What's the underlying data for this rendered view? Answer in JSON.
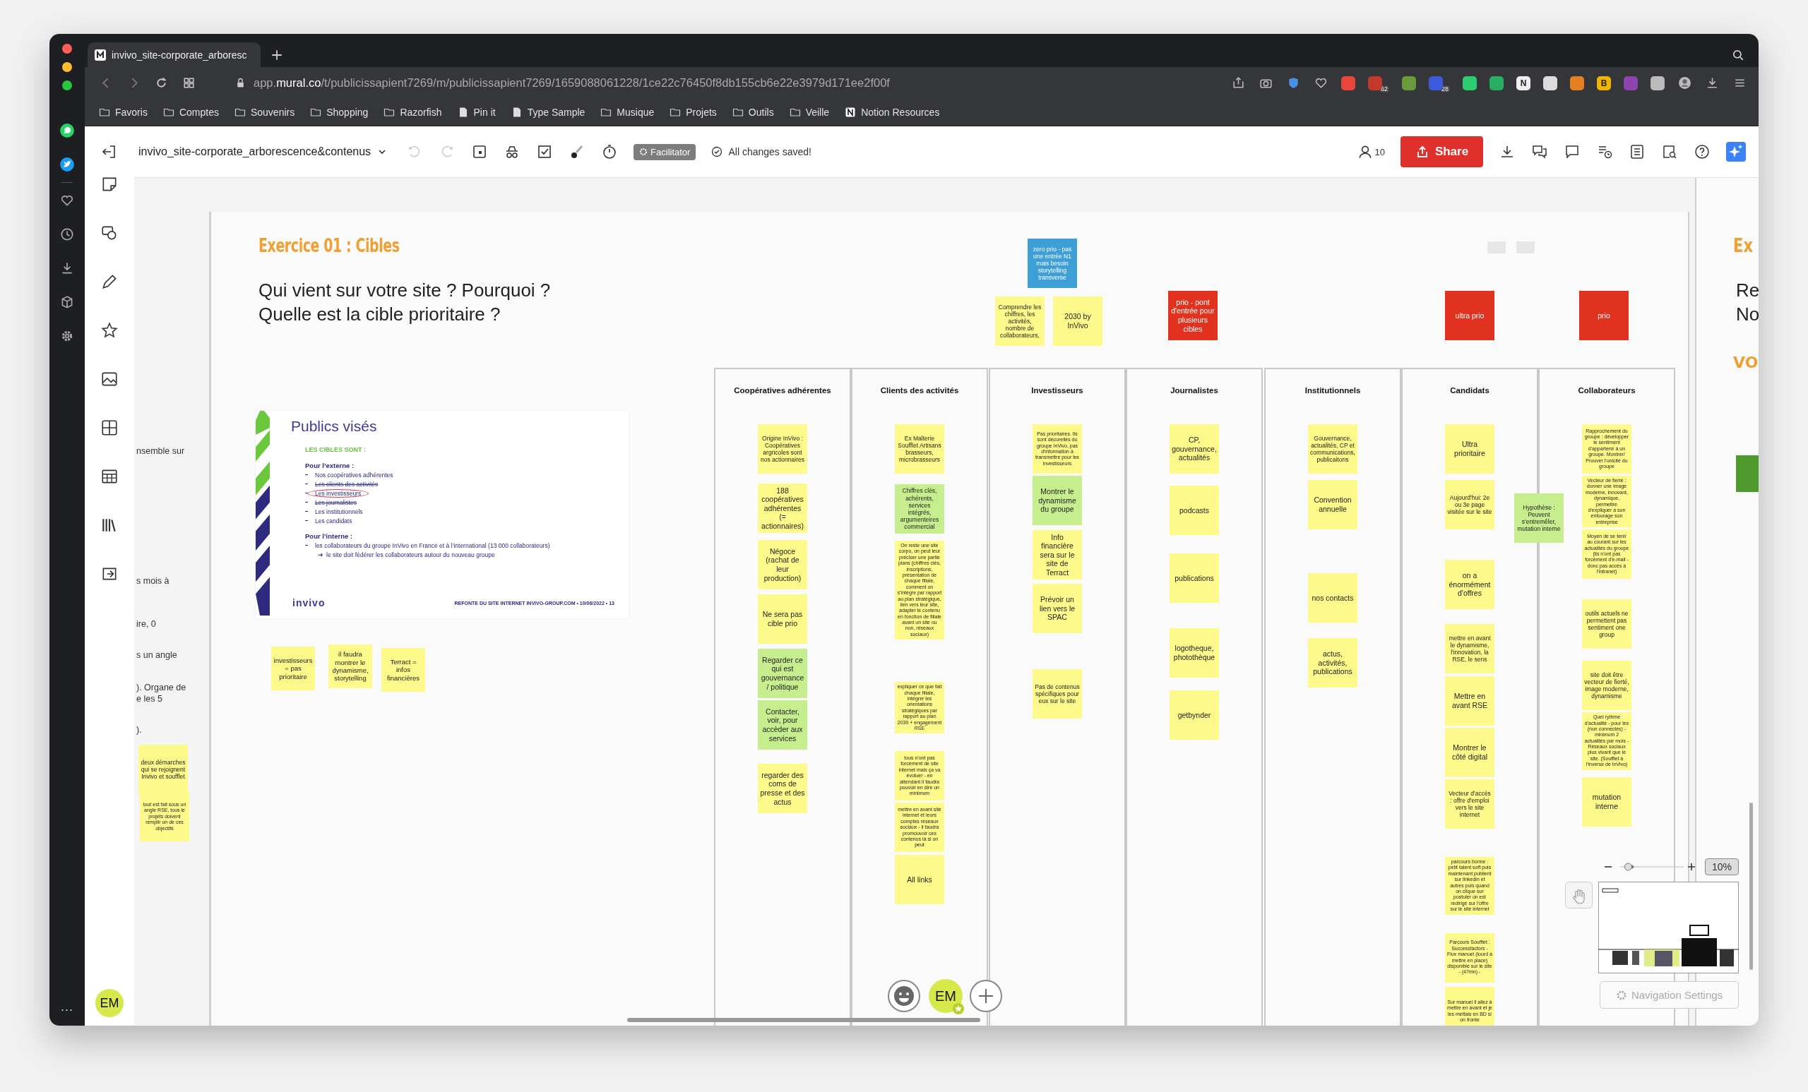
{
  "browser": {
    "tab_title": "invivo_site-corporate_arboresc",
    "url": "app.**mural.co**/t/publicissapient7269/m/publicissapient7269/1659088061228/1ce22c76450f8db155cb6e22e3979d171ee2f00f",
    "more": "...",
    "extensions": [
      {
        "color": "#e8453c"
      },
      {
        "color": "#c0392b",
        "badge": "62"
      },
      {
        "color": "#6a9a3a"
      },
      {
        "color": "#3b5bdb",
        "badge": "28"
      },
      {
        "color": "#2ecc71"
      },
      {
        "color": "#27ae60"
      },
      {
        "color": "#eeeeee",
        "letter": "N"
      },
      {
        "color": "#dddddd"
      },
      {
        "color": "#e67e22"
      },
      {
        "color": "#f1b500",
        "letter": "B"
      },
      {
        "color": "#8e44ad"
      },
      {
        "color": "#bbbbbb"
      }
    ],
    "bookmarks": [
      {
        "label": "Favoris",
        "kind": "folder"
      },
      {
        "label": "Comptes",
        "kind": "folder"
      },
      {
        "label": "Souvenirs",
        "kind": "folder"
      },
      {
        "label": "Shopping",
        "kind": "folder"
      },
      {
        "label": "Razorfish",
        "kind": "folder"
      },
      {
        "label": "Pin it",
        "kind": "page"
      },
      {
        "label": "Type Sample",
        "kind": "page"
      },
      {
        "label": "Musique",
        "kind": "folder"
      },
      {
        "label": "Projets",
        "kind": "folder"
      },
      {
        "label": "Outils",
        "kind": "folder"
      },
      {
        "label": "Veille",
        "kind": "folder"
      },
      {
        "label": "Notion Resources",
        "kind": "notion"
      }
    ]
  },
  "mural": {
    "title": "invivo_site-corporate_arborescence&contenus",
    "facilitator": "Facilitator",
    "saved": "All changes saved!",
    "members": "10",
    "share": "Share",
    "avatar": "EM",
    "facepile_avatar": "EM",
    "zoom": "10%",
    "zoom_slider": {
      "level": 0.08
    },
    "nav_settings": "Navigation Settings"
  },
  "canvas": {
    "left_fragments": [
      "nsemble sur",
      "s mois à",
      "ire, 0",
      "s un angle",
      "). Organe de",
      "e les 5",
      ")."
    ],
    "left_notes": [
      {
        "text": "deux démarches qui se rejoignent Invivo et soufflet",
        "color": "#fdf98a"
      },
      {
        "text": "tout est fait sous un angle RSE, tous le projets doivent remplir un de ces objectifs",
        "color": "#fdf98a"
      }
    ],
    "heading": "Exercice 01 : Cibles",
    "question": [
      "Qui vient sur votre site ? Pourquoi ?",
      "Quelle est la cible prioritaire ?"
    ],
    "slide": {
      "title": "Publics visés",
      "subtitle": "LES CIBLES SONT :",
      "external_label": "Pour l’externe :",
      "external": [
        {
          "text": "Nos coopératives adhérentes",
          "circled": false,
          "struck": false
        },
        {
          "text": "Les clients des activités",
          "circled": false,
          "struck": true
        },
        {
          "text": "Les investisseurs",
          "circled": true,
          "struck": false
        },
        {
          "text": "Les journalistes",
          "circled": false,
          "struck": true
        },
        {
          "text": "Les institutionnels",
          "circled": false,
          "struck": false
        },
        {
          "text": "Les candidats",
          "circled": false,
          "struck": false
        }
      ],
      "internal_label": "Pour l’interne :",
      "internal": "les collaborateurs du groupe InVivo en France et à l’international (13 000 collaborateurs)",
      "internal_arrow": "➔",
      "internal_note": "le site doit fédérer les collaborateurs autour du nouveau groupe",
      "logo": "invivo",
      "footer": "REFONTE DU SITE INTERNET INVIVO-GROUP.COM • 10/06/2022 • 13"
    },
    "under_notes": [
      {
        "text": "investisseurs = pas prioritaire",
        "color": "#fdf98a"
      },
      {
        "text": "il faudra montrer le dynamisme, storytelling",
        "color": "#fdf98a"
      },
      {
        "text": "Terract = infos financières",
        "color": "#fdf98a"
      }
    ],
    "top_notes": [
      {
        "text": "zero prio - pas une entrée N1 mais besoin storytelling transverse",
        "color": "#3d9fd6"
      },
      {
        "text": "Comprendre les chiffres, les activités, nombre de collaborateurs,",
        "color": "#fdf98a"
      },
      {
        "text": "2030 by InVivo",
        "color": "#fdf98a"
      },
      {
        "text": "prio - pont d'entrée pour plusieurs cibles",
        "color": "#e0321f"
      },
      {
        "text": "ultra prio",
        "color": "#e0321f"
      },
      {
        "text": "prio",
        "color": "#e0321f"
      }
    ],
    "columns": [
      {
        "title": "Coopératives adhérentes",
        "notes": [
          {
            "text": "Origine InVivo : Coopératives argricoles sont nos actionnaires",
            "color": "#fdf98a"
          },
          {
            "text": "188 coopératives adhérentes (= actionnaires)",
            "color": "#fdf98a"
          },
          {
            "text": "Négoce (rachat de leur production)",
            "color": "#fdf98a"
          },
          {
            "text": "Ne sera pas cible prio",
            "color": "#fdf98a"
          },
          {
            "text": "Regarder ce qui est gouvernance / politique",
            "color": "#c6ee8e"
          },
          {
            "text": "Contacter, voir, pour accèder aux services",
            "color": "#c6ee8e"
          },
          {
            "text": "regarder des coms de presse et des actus",
            "color": "#fdf98a"
          }
        ]
      },
      {
        "title": "Clients des activités",
        "notes": [
          {
            "text": "Ex Malterie Soufflet Artisans brasseurs, microbrasseurs",
            "color": "#fdf98a"
          },
          {
            "text": "Chiffres clés, achérents, services intégrés, argumenteires commercial",
            "color": "#c6ee8e"
          },
          {
            "text": "On reste une site corpo, on peut leur préciser une partie plans (chiffres clés, inscriptions, présentation de chaque filiale, comment on s'intègre par rapport au plan stratégique, lien vers leur site, adapter le contenu en fonction de filiale avant un site ou non, réseaux sociaux)",
            "color": "#fdf98a"
          },
          {
            "text": "expliquer ce que fait chaque filiale, intégrer les orientations stratégiques par rapport au plan 2030 + engagement RSE",
            "color": "#fdf98a"
          },
          {
            "text": "tous n'ont pas forcément de site internet mais ça va évoluer - en attendant il faudra pouvoir en dire un minimum",
            "color": "#fdf98a"
          },
          {
            "text": "mettre en avant site internet et leurs comptes réseaux sociaux - il faudra promouvoir ces contenus là si on peut",
            "color": "#fdf98a"
          },
          {
            "text": "All links",
            "color": "#fdf98a"
          }
        ]
      },
      {
        "title": "Investisseurs",
        "notes": [
          {
            "text": "Pas prioritaires. Ils sont décorellés du groupe InVivo, pas d'information à transmettre pour les investisseurs",
            "color": "#fdf98a"
          },
          {
            "text": "Montrer le dynamisme du groupe",
            "color": "#c6ee8e"
          },
          {
            "text": "Info financière sera sur le site de Terract",
            "color": "#fdf98a"
          },
          {
            "text": "Prévoir un lien vers le SPAC",
            "color": "#fdf98a"
          },
          {
            "text": "Pas de contenus spécifiques pour eux sur le site",
            "color": "#fdf98a"
          }
        ]
      },
      {
        "title": "Journalistes",
        "notes": [
          {
            "text": "CP, gouvernance, actualités",
            "color": "#fdf98a"
          },
          {
            "text": "podcasts",
            "color": "#fdf98a"
          },
          {
            "text": "publications",
            "color": "#fdf98a"
          },
          {
            "text": "logotheque, photothèque",
            "color": "#fdf98a"
          },
          {
            "text": "getbynder",
            "color": "#fdf98a"
          }
        ]
      },
      {
        "title": "Institutionnels",
        "notes": [
          {
            "text": "Gouvernance, actualités, CP et communications, publicaitons",
            "color": "#fdf98a"
          },
          {
            "text": "Convention annuelle",
            "color": "#fdf98a"
          },
          {
            "text": "nos contacts",
            "color": "#fdf98a"
          },
          {
            "text": "actus, activités, publications",
            "color": "#fdf98a"
          }
        ]
      },
      {
        "title": "Candidats",
        "notes": [
          {
            "text": "Ultra prioritaire",
            "color": "#fdf98a"
          },
          {
            "text": "Aujourd'hui: 2e ou 3e page visitée sur le site",
            "color": "#fdf98a"
          },
          {
            "text": "on a énormément d'offres",
            "color": "#fdf98a"
          },
          {
            "text": "mettre en avant le dynamisme, l'innovation, la RSE, le sens",
            "color": "#fdf98a"
          },
          {
            "text": "Mettre en avant RSE",
            "color": "#fdf98a"
          },
          {
            "text": "Montrer le côté digital",
            "color": "#fdf98a"
          },
          {
            "text": "Vecteur d'accès : offre d'emploi vers le site internet",
            "color": "#fdf98a"
          },
          {
            "text": "parcours bonne : petit talent soft puis maintenant publient sur linkedin et autres puis quand on clique sur postuler on est redirigé sur l'offre sur le site internet",
            "color": "#fdf98a"
          },
          {
            "text": "Parcours Soufflet : Successfactors - Flux manuel (lourd à mettre en place) disponible sur le site - (47mn) -",
            "color": "#fdf98a"
          },
          {
            "text": "Sur manuel il allez à mettre en avant et je les mettais en BD si on fronte",
            "color": "#fdf98a"
          }
        ]
      },
      {
        "title": "Collaborateurs",
        "notes": [
          {
            "text": "Rapprochement du groupe : développer le sentiment d'appartenir à un groupe. Montrer/ Prouver l'unicité du groupe",
            "color": "#fdf98a"
          },
          {
            "text": "Vecteur de fierté : donner une image moderne, innovant, dynamique, permettre d'expliquer à son entourage son entreprise",
            "color": "#fdf98a"
          },
          {
            "text": "Moyen de se tenir au courant sur les actualités du groupe (ils n'ont pas forcément d'e-mail - donc pas accès à l'intranet)",
            "color": "#fdf98a"
          },
          {
            "text": "outils actuels ne permettent pas sentiment one group",
            "color": "#fdf98a"
          },
          {
            "text": "site doit être vecteur de fierté, image moderne, dynamisme",
            "color": "#fdf98a"
          },
          {
            "text": "Quel rythme d'actualité - pour les (non connectés) - minimum 2 actualités par mois - Réseaux sociaux plus vivant que le site. (Soufflet à l'inverse de InVivo)",
            "color": "#fdf98a"
          },
          {
            "text": "mutation interne",
            "color": "#fdf98a"
          }
        ]
      }
    ],
    "hypothesis_note": {
      "text": "Hypothèse : Peuvent s'entremêler, mutation interne",
      "color": "#c6ee8e"
    },
    "next_board": {
      "heading": "Ex",
      "question": [
        "Re",
        "No"
      ],
      "accent": "VO"
    }
  }
}
